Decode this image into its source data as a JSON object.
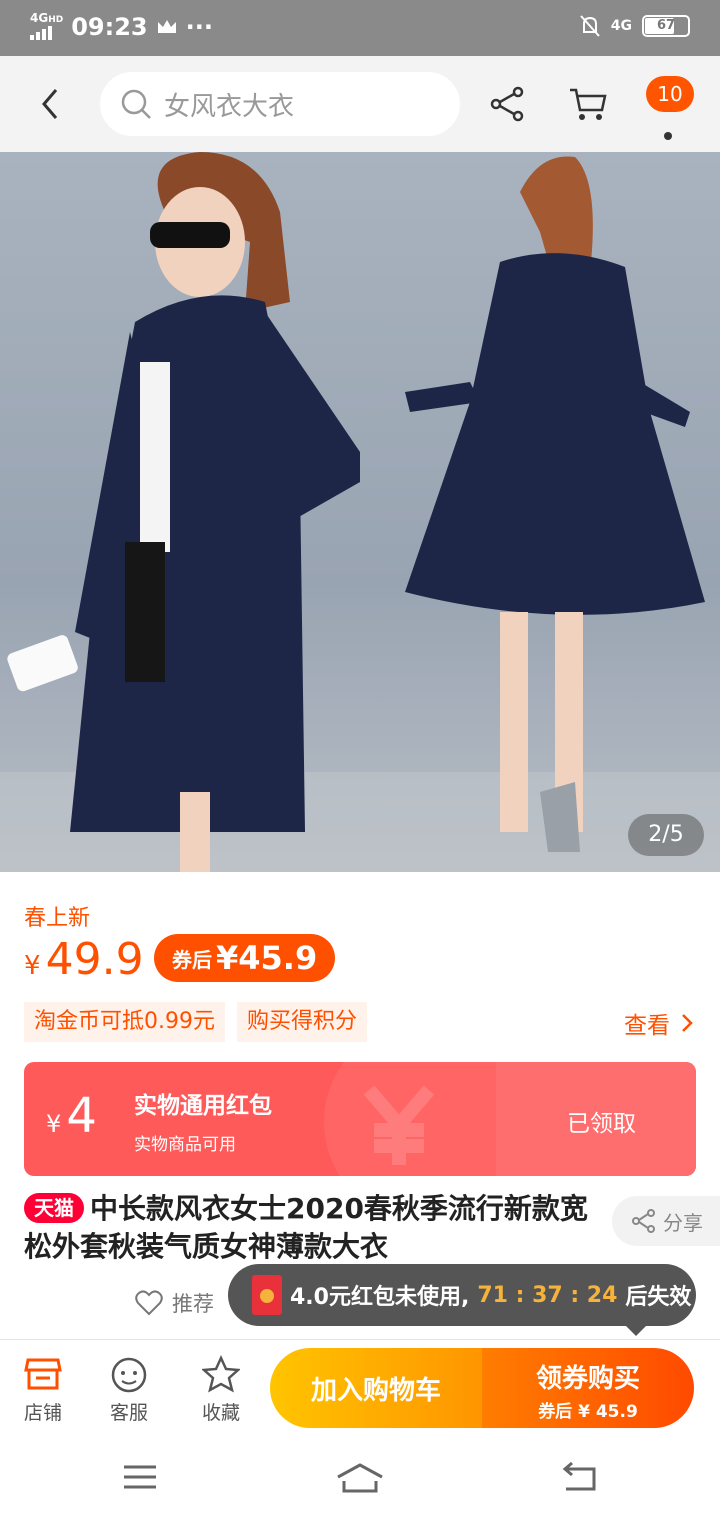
{
  "status_bar": {
    "network": "4G",
    "network_sub": "HD",
    "time": "09:23",
    "right_network": "4G",
    "battery": "67"
  },
  "header": {
    "search_placeholder": "女风衣大衣",
    "cart_badge": "10"
  },
  "gallery": {
    "counter": "2/5"
  },
  "price_section": {
    "new_tag": "春上新",
    "currency": "¥",
    "price": "49.9",
    "coupon_label": "券后",
    "coupon_price": "¥45.9",
    "tags": [
      "淘金币可抵0.99元",
      "购买得积分"
    ],
    "view_label": "查看"
  },
  "red_packet": {
    "currency": "¥",
    "amount": "4",
    "title": "实物通用红包",
    "subtitle": "实物商品可用",
    "state": "已领取"
  },
  "product": {
    "store_badge": "天猫",
    "title": "中长款风衣女士2020春秋季流行新款宽松外套秋装气质女神薄款大衣",
    "share_label": "分享",
    "recommend_label": "推荐"
  },
  "toast": {
    "message": "4.0元红包未使用,",
    "countdown": "71 : 37 : 24",
    "suffix": "后失效"
  },
  "bottom_bar": {
    "store": "店铺",
    "service": "客服",
    "favorite": "收藏",
    "add_cart": "加入购物车",
    "buy_title": "领券购买",
    "buy_sub": "券后 ¥ 45.9"
  },
  "colors": {
    "accent": "#ff5000",
    "tmall_red": "#ff0036",
    "red_packet": "#ff5a5a",
    "cart_button": "#ffb000",
    "buy_button": "#ff5a00"
  }
}
